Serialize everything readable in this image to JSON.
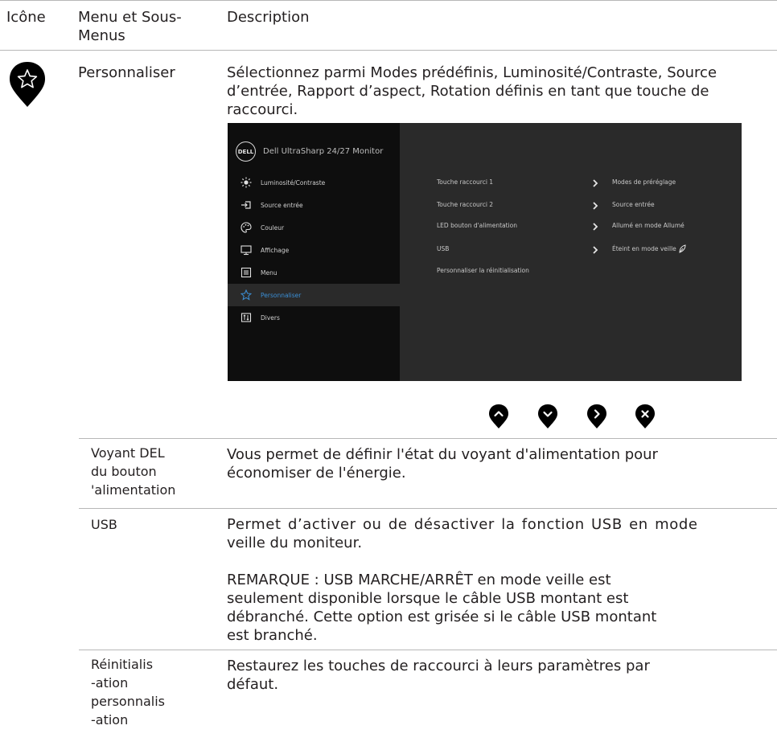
{
  "header": {
    "col_icon": "Icône",
    "col_menu": "Menu et Sous-Menus",
    "col_desc": "Description"
  },
  "main": {
    "menu_name": "Personnaliser",
    "description": "Sélectionnez parmi Modes prédéfinis, Luminosité/Contraste, Source d’entrée, Rapport d’aspect, Rotation définis en tant que touche de raccourci.",
    "icon": "star-pin-icon"
  },
  "osd": {
    "title": "Dell UltraSharp 24/27 Monitor",
    "logo_text": "DELL",
    "menu": [
      {
        "label": "Luminosité/Contraste",
        "icon": "brightness-icon"
      },
      {
        "label": "Source entrée",
        "icon": "input-source-icon"
      },
      {
        "label": "Couleur",
        "icon": "palette-icon"
      },
      {
        "label": "Affichage",
        "icon": "display-icon"
      },
      {
        "label": "Menu",
        "icon": "menu-icon"
      },
      {
        "label": "Personnaliser",
        "icon": "star-icon",
        "selected": true
      },
      {
        "label": "Divers",
        "icon": "others-icon"
      }
    ],
    "options": [
      {
        "label": "Touche raccourci 1",
        "value": "Modes de préréglage"
      },
      {
        "label": "Touche raccourci 2",
        "value": "Source entrée"
      },
      {
        "label": "LED bouton d'alimentation",
        "value": "Allumé en mode Allumé"
      },
      {
        "label": "USB",
        "value": "Éteint en mode veille"
      },
      {
        "label": "Personnaliser la réinitialisation",
        "value": ""
      }
    ],
    "colors": {
      "left_panel": "#0e0e0e",
      "right_panel": "#2a2a2a",
      "selected": "#3b8fd6"
    }
  },
  "nav_buttons": [
    {
      "icon": "up-icon"
    },
    {
      "icon": "down-icon"
    },
    {
      "icon": "right-icon"
    },
    {
      "icon": "close-icon"
    }
  ],
  "rows": [
    {
      "name": "Voyant DEL du bouton 'alimentation",
      "name_lines": [
        "Voyant DEL",
        "du bouton",
        "'alimentation"
      ],
      "desc_lines": [
        "Vous permet de définir l'état du voyant d'alimentation pour",
        "économiser de l'énergie."
      ]
    },
    {
      "name": "USB",
      "desc_lines": [
        "Permet d’activer ou de désactiver la fonction USB en mode",
        "veille du moniteur."
      ],
      "note_lines": [
        "REMARQUE : USB MARCHE/ARRÊT en mode veille est",
        "seulement disponible lorsque le câble USB montant est",
        "débranché. Cette option est grisée si le câble USB montant",
        "est branché."
      ]
    },
    {
      "name": "Réinitialisation personnalisation",
      "name_lines": [
        "Réinitialis",
        "-ation",
        "personnalis",
        "-ation"
      ],
      "desc_lines": [
        "Restaurez les touches de raccourci à leurs paramètres par",
        "défaut."
      ]
    }
  ]
}
